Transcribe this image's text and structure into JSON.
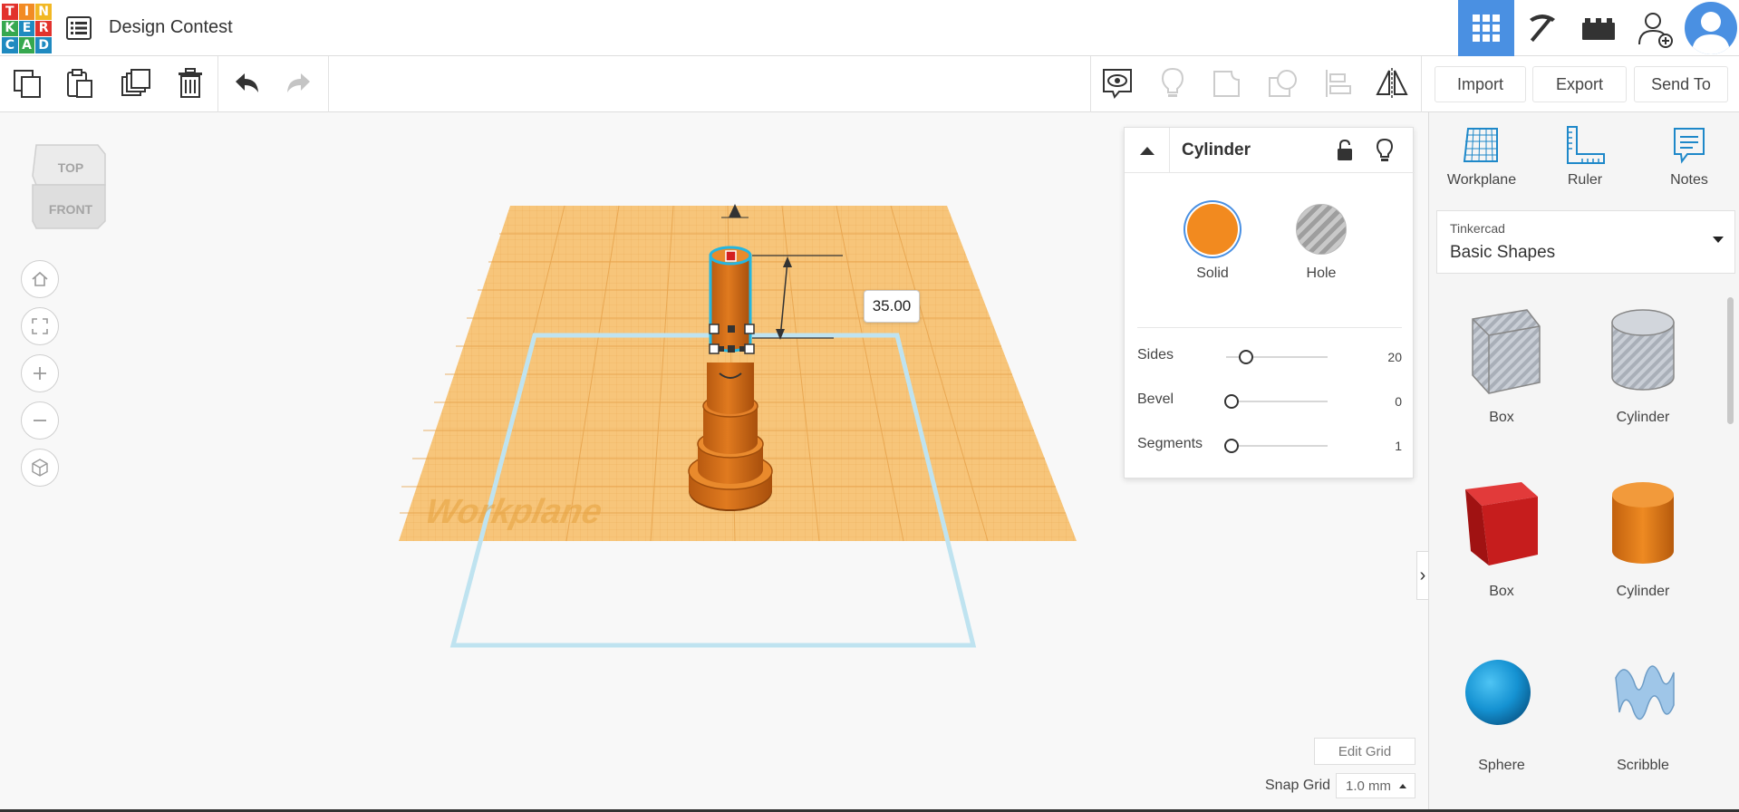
{
  "app": {
    "logo_letters": [
      "T",
      "I",
      "N",
      "K",
      "E",
      "R",
      "C",
      "A",
      "D"
    ],
    "logo_colors": [
      "#e2322d",
      "#f28b24",
      "#f2b824",
      "#36a84f",
      "#1f8ac0",
      "#e2322d",
      "#1f8ac0",
      "#36a84f",
      "#1f8ac0"
    ],
    "design_title": "Design Contest",
    "accent_color": "#4a90e2"
  },
  "top_nav": {
    "views": [
      {
        "icon": "grid-view-icon",
        "active": true
      },
      {
        "icon": "pickaxe-icon",
        "active": false
      },
      {
        "icon": "bricks-icon",
        "active": false
      },
      {
        "icon": "add-user-icon",
        "active": false
      }
    ]
  },
  "toolbar": {
    "edit_tools": [
      "copy-icon",
      "paste-icon",
      "duplicate-icon",
      "delete-icon",
      "undo-icon",
      "redo-icon"
    ],
    "view_tools": [
      "notes-visibility-icon",
      "lightbulb-icon",
      "group-icon",
      "ungroup-icon",
      "align-icon",
      "mirror-icon"
    ],
    "import_label": "Import",
    "export_label": "Export",
    "send_to_label": "Send To"
  },
  "viewcube": {
    "top_label": "TOP",
    "front_label": "FRONT"
  },
  "nav_controls": [
    "home-view-icon",
    "fit-view-icon",
    "zoom-in-icon",
    "zoom-out-icon",
    "perspective-icon"
  ],
  "scene": {
    "dimension_value": "35.00",
    "workplane_label": "Workplane",
    "object_color": "#e07a1f",
    "workplane_color": "#f7c57a"
  },
  "inspector": {
    "title": "Cylinder",
    "solid_label": "Solid",
    "hole_label": "Hole",
    "solid_color": "#f28a1f",
    "properties": [
      {
        "label": "Sides",
        "value": "20",
        "level": 0.1
      },
      {
        "label": "Bevel",
        "value": "0",
        "level": 0
      },
      {
        "label": "Segments",
        "value": "1",
        "level": 0
      }
    ]
  },
  "grid": {
    "edit_grid_label": "Edit Grid",
    "snap_label": "Snap Grid",
    "snap_value": "1.0 mm"
  },
  "right_panel": {
    "tools": [
      {
        "label": "Workplane",
        "icon": "workplane-icon"
      },
      {
        "label": "Ruler",
        "icon": "ruler-icon"
      },
      {
        "label": "Notes",
        "icon": "notes-icon"
      }
    ],
    "library_source": "Tinkercad",
    "library_name": "Basic Shapes",
    "shapes": [
      {
        "label": "Box",
        "kind": "hole-box"
      },
      {
        "label": "Cylinder",
        "kind": "hole-cylinder"
      },
      {
        "label": "Box",
        "kind": "box"
      },
      {
        "label": "Cylinder",
        "kind": "cylinder"
      },
      {
        "label": "Sphere",
        "kind": "sphere"
      },
      {
        "label": "Scribble",
        "kind": "scribble"
      }
    ]
  }
}
